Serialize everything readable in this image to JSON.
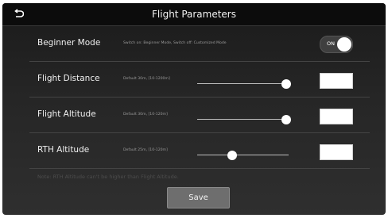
{
  "header": {
    "title": "Flight Parameters"
  },
  "rows": [
    {
      "label": "Beginner Mode",
      "hint": "Switch on: Beginner Mode, Switch off: Customized Mode",
      "toggle": {
        "text": "ON",
        "state": true
      }
    },
    {
      "label": "Flight Distance",
      "hint": "Default 30m, [10-1200m]",
      "slider_fraction": 0.97,
      "value": ""
    },
    {
      "label": "Flight Altitude",
      "hint": "Default 30m, [10-120m]",
      "slider_fraction": 0.97,
      "value": ""
    },
    {
      "label": "RTH Altitude",
      "hint": "Default 25m, [10-120m]",
      "slider_fraction": 0.38,
      "value": ""
    }
  ],
  "note": "Note: RTH Altitude can't be higher than Flight Altitude.",
  "save_label": "Save",
  "icons": {
    "back": "back-arrow-icon"
  }
}
